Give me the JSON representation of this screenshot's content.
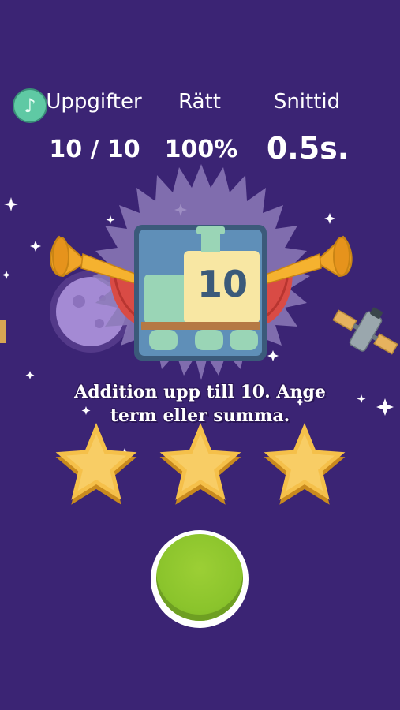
{
  "stats": {
    "tasks_label": "Uppgifter",
    "tasks_value": "10 / 10",
    "correct_label": "Rätt",
    "correct_value": "100%",
    "avg_time_label": "Snittid",
    "avg_time_value": "0.5s."
  },
  "badge": {
    "number": "10"
  },
  "description": {
    "line1": "Addition upp till 10. Ange",
    "line2": "term eller summa."
  },
  "stars_earned": 3,
  "stars_total": 3,
  "icons": {
    "music": "music-note-icon",
    "play": "play-button"
  },
  "colors": {
    "background": "#3b2474",
    "star": "#f5c04a",
    "play_button": "#8bc42c",
    "music_button": "#5fc9a4"
  }
}
